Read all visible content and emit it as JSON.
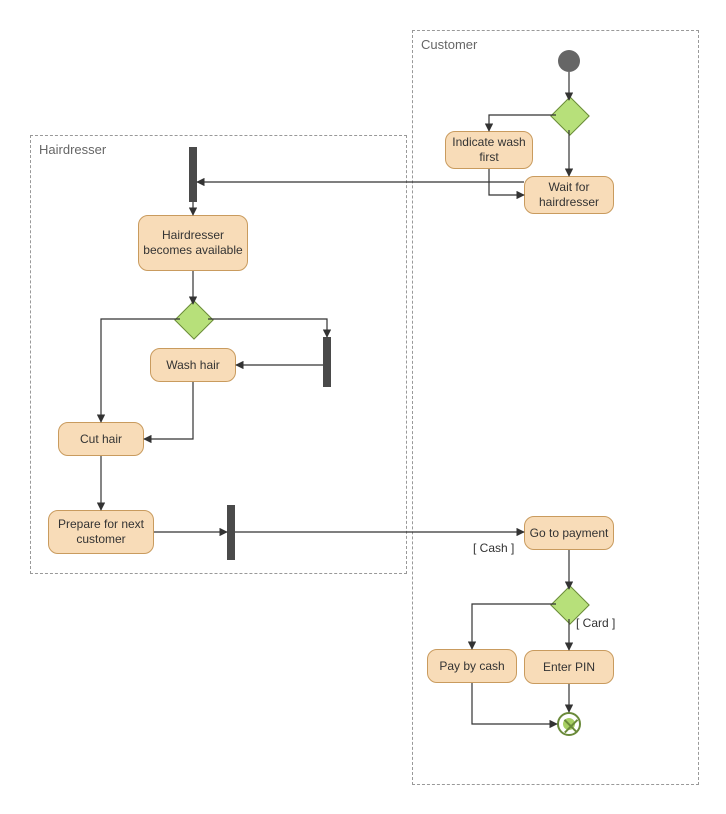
{
  "swimlanes": {
    "hairdresser": {
      "label": "Hairdresser"
    },
    "customer": {
      "label": "Customer"
    }
  },
  "activities": {
    "indicate_wash_first": "Indicate wash first",
    "wait_for_hairdresser": "Wait for hairdresser",
    "hairdresser_available": "Hairdresser becomes available",
    "wash_hair": "Wash hair",
    "cut_hair": "Cut hair",
    "prepare_next": "Prepare for next customer",
    "go_to_payment": "Go to payment",
    "pay_by_cash": "Pay by cash",
    "enter_pin": "Enter PIN"
  },
  "guards": {
    "cash": "[ Cash ]",
    "card": "[ Card ]"
  },
  "chart_data": {
    "type": "uml-activity",
    "swimlanes": [
      "Hairdresser",
      "Customer"
    ],
    "initial": "start",
    "final": "end",
    "nodes": [
      {
        "id": "start",
        "type": "initial",
        "lane": "Customer"
      },
      {
        "id": "d1",
        "type": "decision",
        "lane": "Customer"
      },
      {
        "id": "indicate_wash_first",
        "type": "action",
        "lane": "Customer",
        "label": "Indicate wash first"
      },
      {
        "id": "wait_for_hairdresser",
        "type": "action",
        "lane": "Customer",
        "label": "Wait for hairdresser"
      },
      {
        "id": "fork1",
        "type": "fork",
        "lane": "Hairdresser"
      },
      {
        "id": "hairdresser_available",
        "type": "action",
        "lane": "Hairdresser",
        "label": "Hairdresser becomes available"
      },
      {
        "id": "d2",
        "type": "decision",
        "lane": "Hairdresser"
      },
      {
        "id": "fork2",
        "type": "fork",
        "lane": "Hairdresser"
      },
      {
        "id": "wash_hair",
        "type": "action",
        "lane": "Hairdresser",
        "label": "Wash hair"
      },
      {
        "id": "cut_hair",
        "type": "action",
        "lane": "Hairdresser",
        "label": "Cut hair"
      },
      {
        "id": "prepare_next",
        "type": "action",
        "lane": "Hairdresser",
        "label": "Prepare for next customer"
      },
      {
        "id": "join1",
        "type": "join",
        "lane": "Hairdresser"
      },
      {
        "id": "go_to_payment",
        "type": "action",
        "lane": "Customer",
        "label": "Go to payment"
      },
      {
        "id": "d3",
        "type": "decision",
        "lane": "Customer"
      },
      {
        "id": "pay_by_cash",
        "type": "action",
        "lane": "Customer",
        "label": "Pay by cash"
      },
      {
        "id": "enter_pin",
        "type": "action",
        "lane": "Customer",
        "label": "Enter PIN"
      },
      {
        "id": "end",
        "type": "final",
        "lane": "Customer"
      }
    ],
    "edges": [
      {
        "from": "start",
        "to": "d1"
      },
      {
        "from": "d1",
        "to": "indicate_wash_first"
      },
      {
        "from": "d1",
        "to": "wait_for_hairdresser"
      },
      {
        "from": "indicate_wash_first",
        "to": "wait_for_hairdresser"
      },
      {
        "from": "wait_for_hairdresser",
        "to": "fork1"
      },
      {
        "from": "fork1",
        "to": "hairdresser_available"
      },
      {
        "from": "hairdresser_available",
        "to": "d2"
      },
      {
        "from": "d2",
        "to": "cut_hair"
      },
      {
        "from": "d2",
        "to": "fork2"
      },
      {
        "from": "fork2",
        "to": "wash_hair"
      },
      {
        "from": "wash_hair",
        "to": "cut_hair"
      },
      {
        "from": "cut_hair",
        "to": "prepare_next"
      },
      {
        "from": "prepare_next",
        "to": "join1"
      },
      {
        "from": "join1",
        "to": "go_to_payment"
      },
      {
        "from": "go_to_payment",
        "to": "d3"
      },
      {
        "from": "d3",
        "to": "pay_by_cash",
        "guard": "[ Cash ]"
      },
      {
        "from": "d3",
        "to": "enter_pin",
        "guard": "[ Card ]"
      },
      {
        "from": "pay_by_cash",
        "to": "end"
      },
      {
        "from": "enter_pin",
        "to": "end"
      }
    ]
  }
}
